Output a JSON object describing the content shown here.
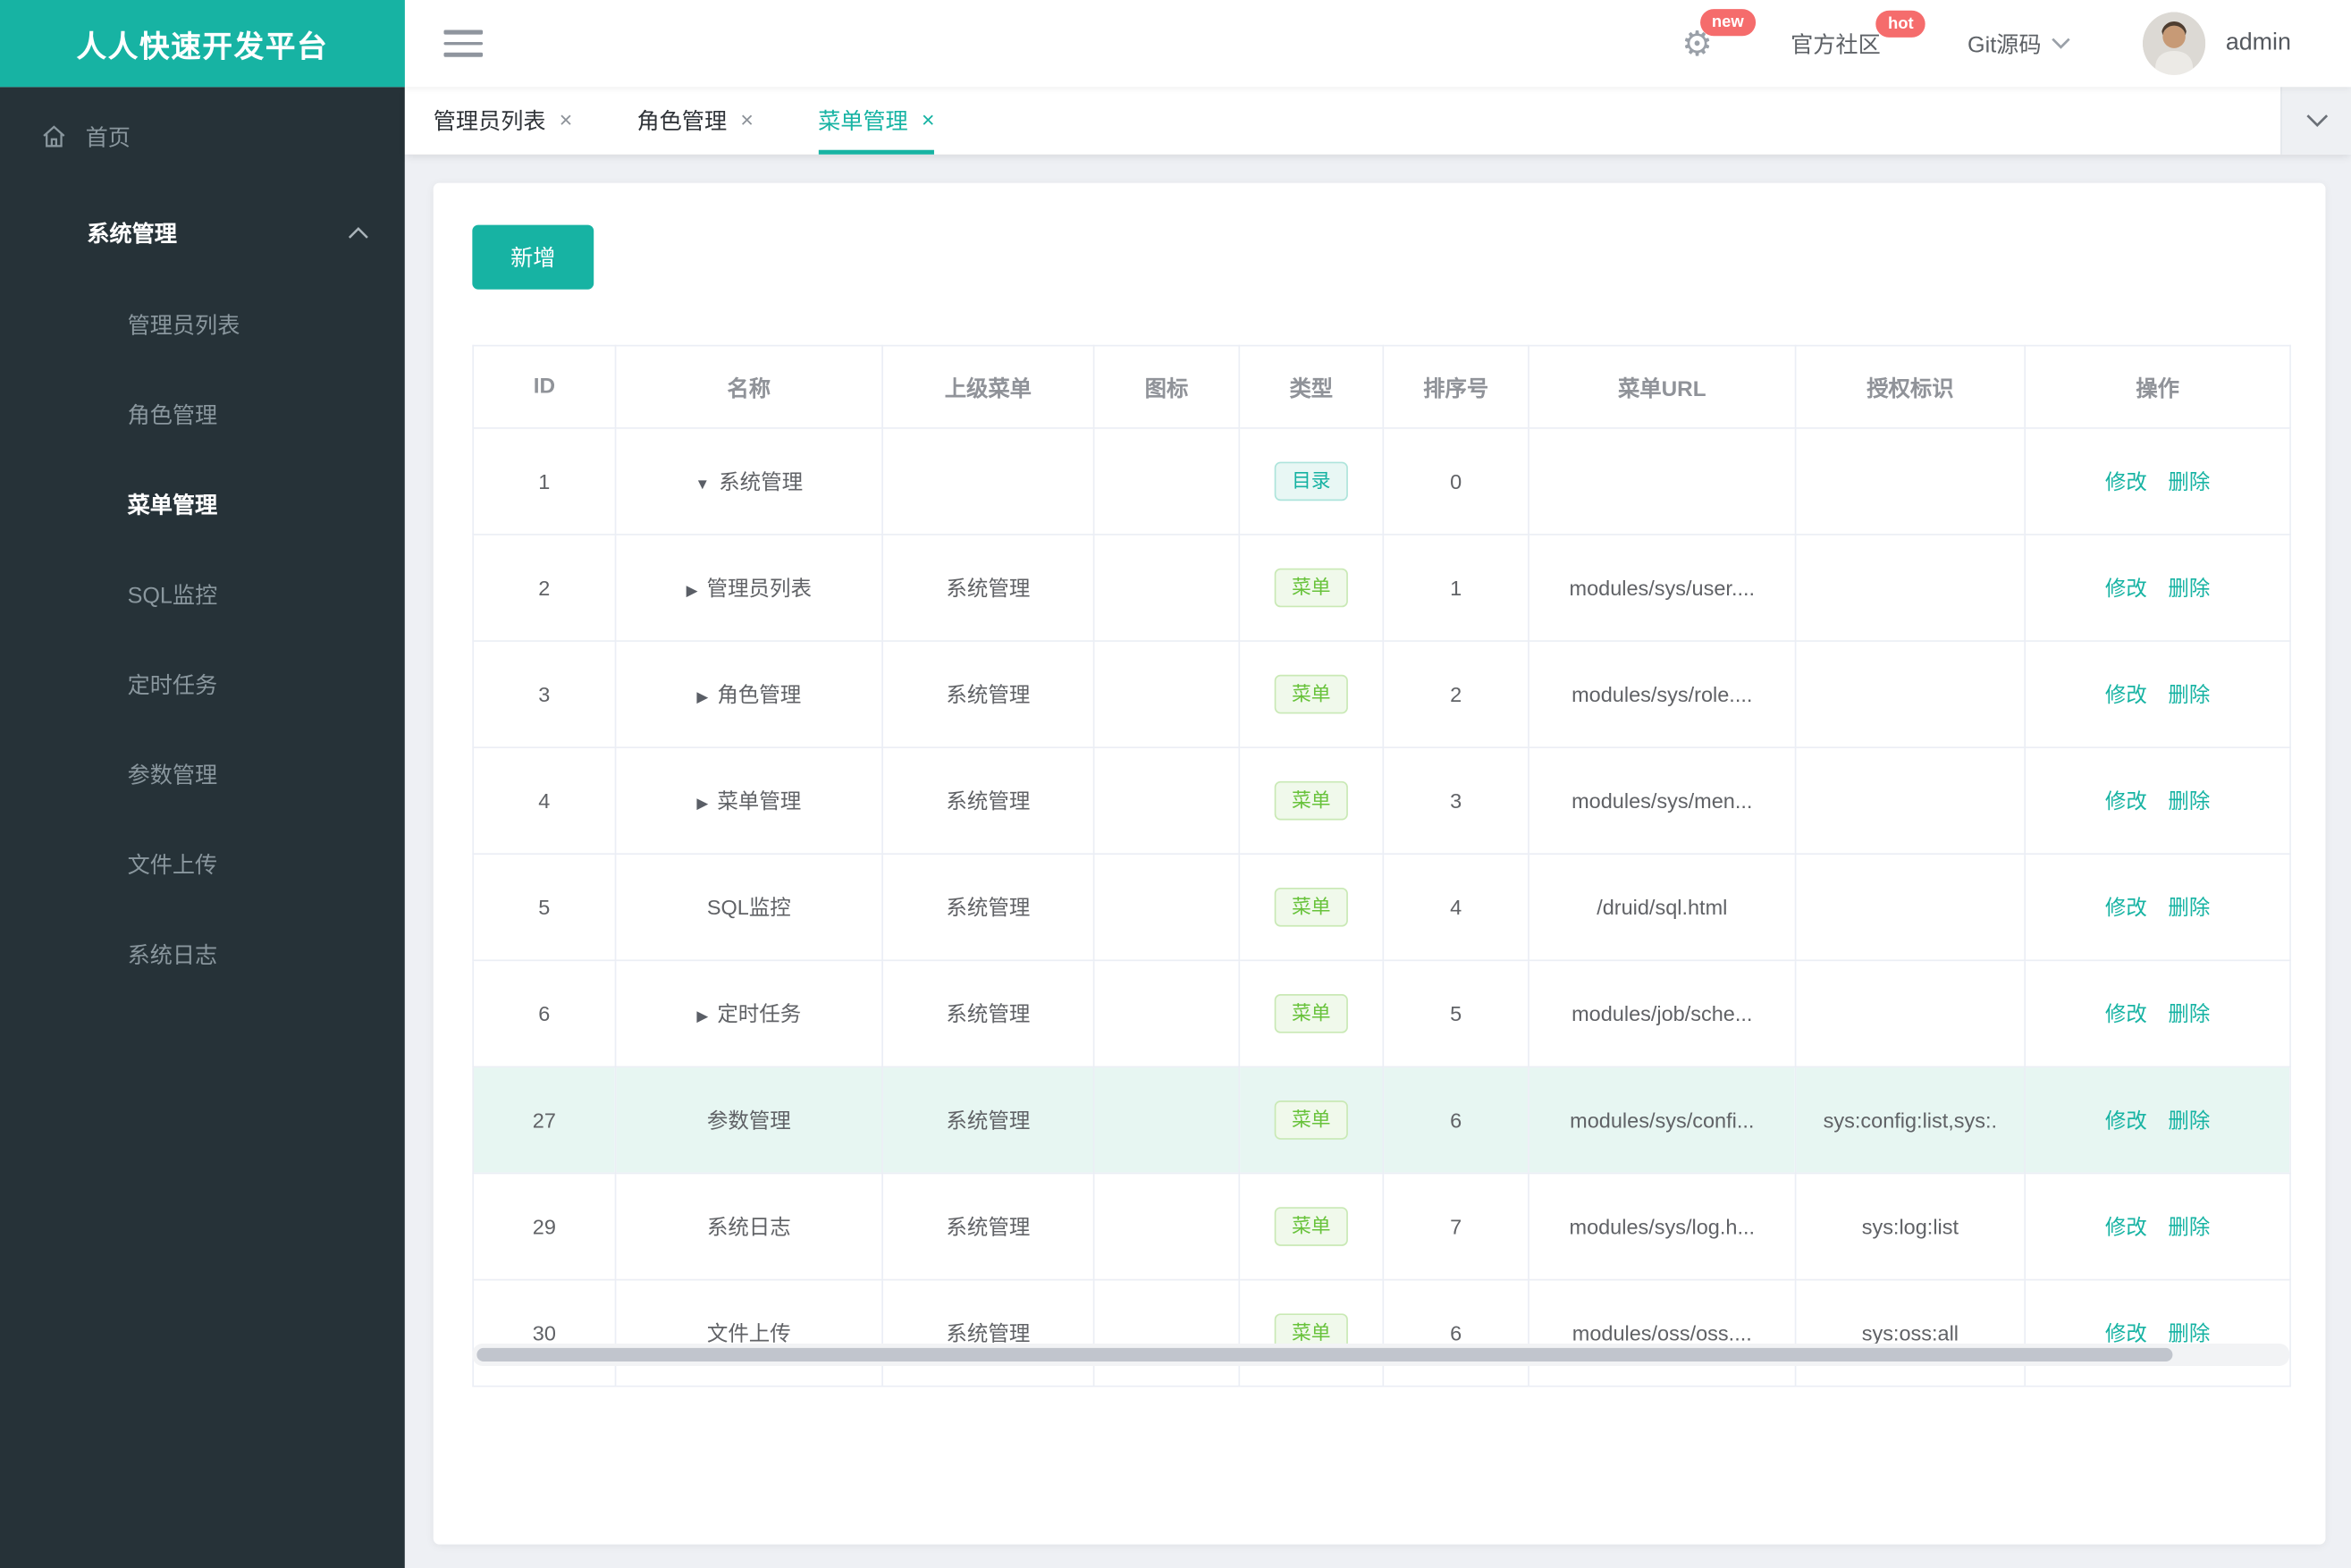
{
  "brand": {
    "title": "人人快速开发平台"
  },
  "topbar": {
    "settings_badge": "new",
    "community_label": "官方社区",
    "community_badge": "hot",
    "git_label": "Git源码",
    "username": "admin"
  },
  "sidebar": {
    "home_label": "首页",
    "group_label": "系统管理",
    "items": [
      {
        "label": "管理员列表",
        "active": false
      },
      {
        "label": "角色管理",
        "active": false
      },
      {
        "label": "菜单管理",
        "active": true
      },
      {
        "label": "SQL监控",
        "active": false
      },
      {
        "label": "定时任务",
        "active": false
      },
      {
        "label": "参数管理",
        "active": false
      },
      {
        "label": "文件上传",
        "active": false
      },
      {
        "label": "系统日志",
        "active": false
      }
    ]
  },
  "tabs": [
    {
      "label": "管理员列表",
      "close": "×",
      "active": false
    },
    {
      "label": "角色管理",
      "close": "×",
      "active": false
    },
    {
      "label": "菜单管理",
      "close": "×",
      "active": true
    }
  ],
  "toolbar": {
    "add_label": "新增"
  },
  "table": {
    "columns": [
      "ID",
      "名称",
      "上级菜单",
      "图标",
      "类型",
      "排序号",
      "菜单URL",
      "授权标识",
      "操作"
    ],
    "arrows": {
      "down": "▼",
      "right": "▶",
      "none": ""
    },
    "actions": {
      "edit": "修改",
      "delete": "删除"
    },
    "rows": [
      {
        "id": "1",
        "arrow": "down",
        "name": "系统管理",
        "parent": "",
        "icon": "",
        "type_label": "目录",
        "type_kind": "dir",
        "order": "0",
        "url": "",
        "perms": "",
        "highlight": false
      },
      {
        "id": "2",
        "arrow": "right",
        "name": "管理员列表",
        "parent": "系统管理",
        "icon": "",
        "type_label": "菜单",
        "type_kind": "menu",
        "order": "1",
        "url": "modules/sys/user....",
        "perms": "",
        "highlight": false
      },
      {
        "id": "3",
        "arrow": "right",
        "name": "角色管理",
        "parent": "系统管理",
        "icon": "",
        "type_label": "菜单",
        "type_kind": "menu",
        "order": "2",
        "url": "modules/sys/role....",
        "perms": "",
        "highlight": false
      },
      {
        "id": "4",
        "arrow": "right",
        "name": "菜单管理",
        "parent": "系统管理",
        "icon": "",
        "type_label": "菜单",
        "type_kind": "menu",
        "order": "3",
        "url": "modules/sys/men...",
        "perms": "",
        "highlight": false
      },
      {
        "id": "5",
        "arrow": "none",
        "name": "SQL监控",
        "parent": "系统管理",
        "icon": "",
        "type_label": "菜单",
        "type_kind": "menu",
        "order": "4",
        "url": "/druid/sql.html",
        "perms": "",
        "highlight": false
      },
      {
        "id": "6",
        "arrow": "right",
        "name": "定时任务",
        "parent": "系统管理",
        "icon": "",
        "type_label": "菜单",
        "type_kind": "menu",
        "order": "5",
        "url": "modules/job/sche...",
        "perms": "",
        "highlight": false
      },
      {
        "id": "27",
        "arrow": "none",
        "name": "参数管理",
        "parent": "系统管理",
        "icon": "",
        "type_label": "菜单",
        "type_kind": "menu",
        "order": "6",
        "url": "modules/sys/confi...",
        "perms": "sys:config:list,sys:.",
        "highlight": true
      },
      {
        "id": "29",
        "arrow": "none",
        "name": "系统日志",
        "parent": "系统管理",
        "icon": "",
        "type_label": "菜单",
        "type_kind": "menu",
        "order": "7",
        "url": "modules/sys/log.h...",
        "perms": "sys:log:list",
        "highlight": false
      },
      {
        "id": "30",
        "arrow": "none",
        "name": "文件上传",
        "parent": "系统管理",
        "icon": "",
        "type_label": "菜单",
        "type_kind": "menu",
        "order": "6",
        "url": "modules/oss/oss....",
        "perms": "sys:oss:all",
        "highlight": false
      }
    ]
  },
  "colors": {
    "accent_teal": "#17b3a3",
    "sidebar_bg": "#263238",
    "badge_red": "#f56c6c",
    "tag_green": "#67c23a",
    "highlight_row": "#e7f6f2"
  }
}
